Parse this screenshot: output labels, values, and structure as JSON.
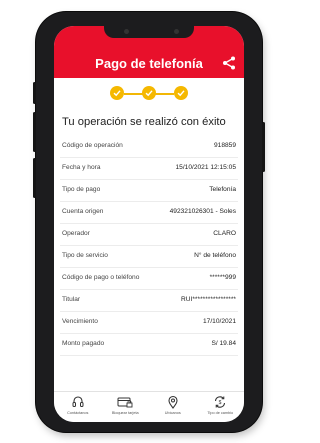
{
  "header": {
    "title": "Pago de telefonía",
    "accent_color": "#e8102b"
  },
  "progress": {
    "steps_completed": 3,
    "steps_total": 3,
    "step_color": "#f5b800"
  },
  "headline": "Tu operación se realizó con éxito",
  "details": [
    {
      "label": "Código de operación",
      "value": "918859"
    },
    {
      "label": "Fecha y hora",
      "value": "15/10/2021 12:15:05"
    },
    {
      "label": "Tipo de pago",
      "value": "Telefonía"
    },
    {
      "label": "Cuenta origen",
      "value": "492321026301 - Soles"
    },
    {
      "label": "Operador",
      "value": "CLARO"
    },
    {
      "label": "Tipo de servicio",
      "value": "N° de teléfono"
    },
    {
      "label": "Código de pago o teléfono",
      "value": "******999"
    },
    {
      "label": "Titular",
      "value": "RUI*****************"
    },
    {
      "label": "Vencimiento",
      "value": "17/10/2021"
    },
    {
      "label": "Monto pagado",
      "value": "S/ 19.84"
    }
  ],
  "bottom_nav": [
    {
      "label": "Contáctanos",
      "icon": "headset-icon"
    },
    {
      "label": "Bloquear tarjeta",
      "icon": "card-lock-icon"
    },
    {
      "label": "Ubícanos",
      "icon": "location-pin-icon"
    },
    {
      "label": "Tipo de cambio",
      "icon": "exchange-icon"
    }
  ]
}
